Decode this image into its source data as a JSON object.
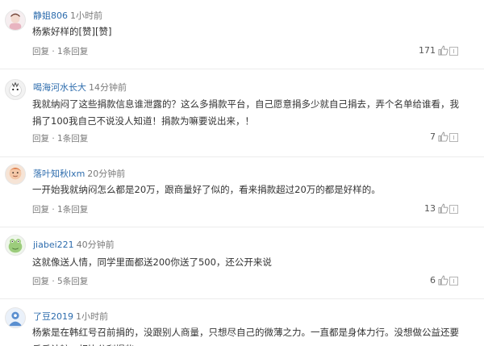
{
  "comments": [
    {
      "username": "静姐806",
      "time": "1小时前",
      "text": "杨紫好样的[赞][赞]",
      "reply_label": "回复",
      "sub_replies": "1条回复",
      "likes": "171"
    },
    {
      "username": "喝海河水长大",
      "time": "14分钟前",
      "text": "我就纳闷了这些捐款信息谁泄露的？这么多捐款平台，自己愿意捐多少就自己捐去，弄个名单给谁看，我捐了100我自己不说没人知道！捐款为嘛要说出来，！",
      "reply_label": "回复",
      "sub_replies": "1条回复",
      "likes": "7"
    },
    {
      "username": "落叶知秋lxm",
      "time": "20分钟前",
      "text": "一开始我就纳闷怎么都是20万，跟商量好了似的，看来捐款超过20万的都是好样的。",
      "reply_label": "回复",
      "sub_replies": "1条回复",
      "likes": "13"
    },
    {
      "username": "jiabei221",
      "time": "40分钟前",
      "text": "这就像送人情，同学里面都送200你送了500，还公开来说",
      "reply_label": "回复",
      "sub_replies": "5条回复",
      "likes": "6"
    },
    {
      "username": "了豆2019",
      "time": "1小时前",
      "text": "杨紫是在韩红号召前捐的，没跟别人商量，只想尽自己的微薄之力。一直都是身体力行。没想做公益还要斤斤计较，相比分利慢些",
      "reply_label": "",
      "sub_replies": "",
      "likes": ""
    }
  ],
  "colors": {
    "username": "#2d6cad",
    "meta": "#7a7a7a",
    "text": "#333333",
    "divider": "#ececec"
  },
  "icons": {
    "like": "thumbs-up-icon",
    "report": "report-icon"
  }
}
